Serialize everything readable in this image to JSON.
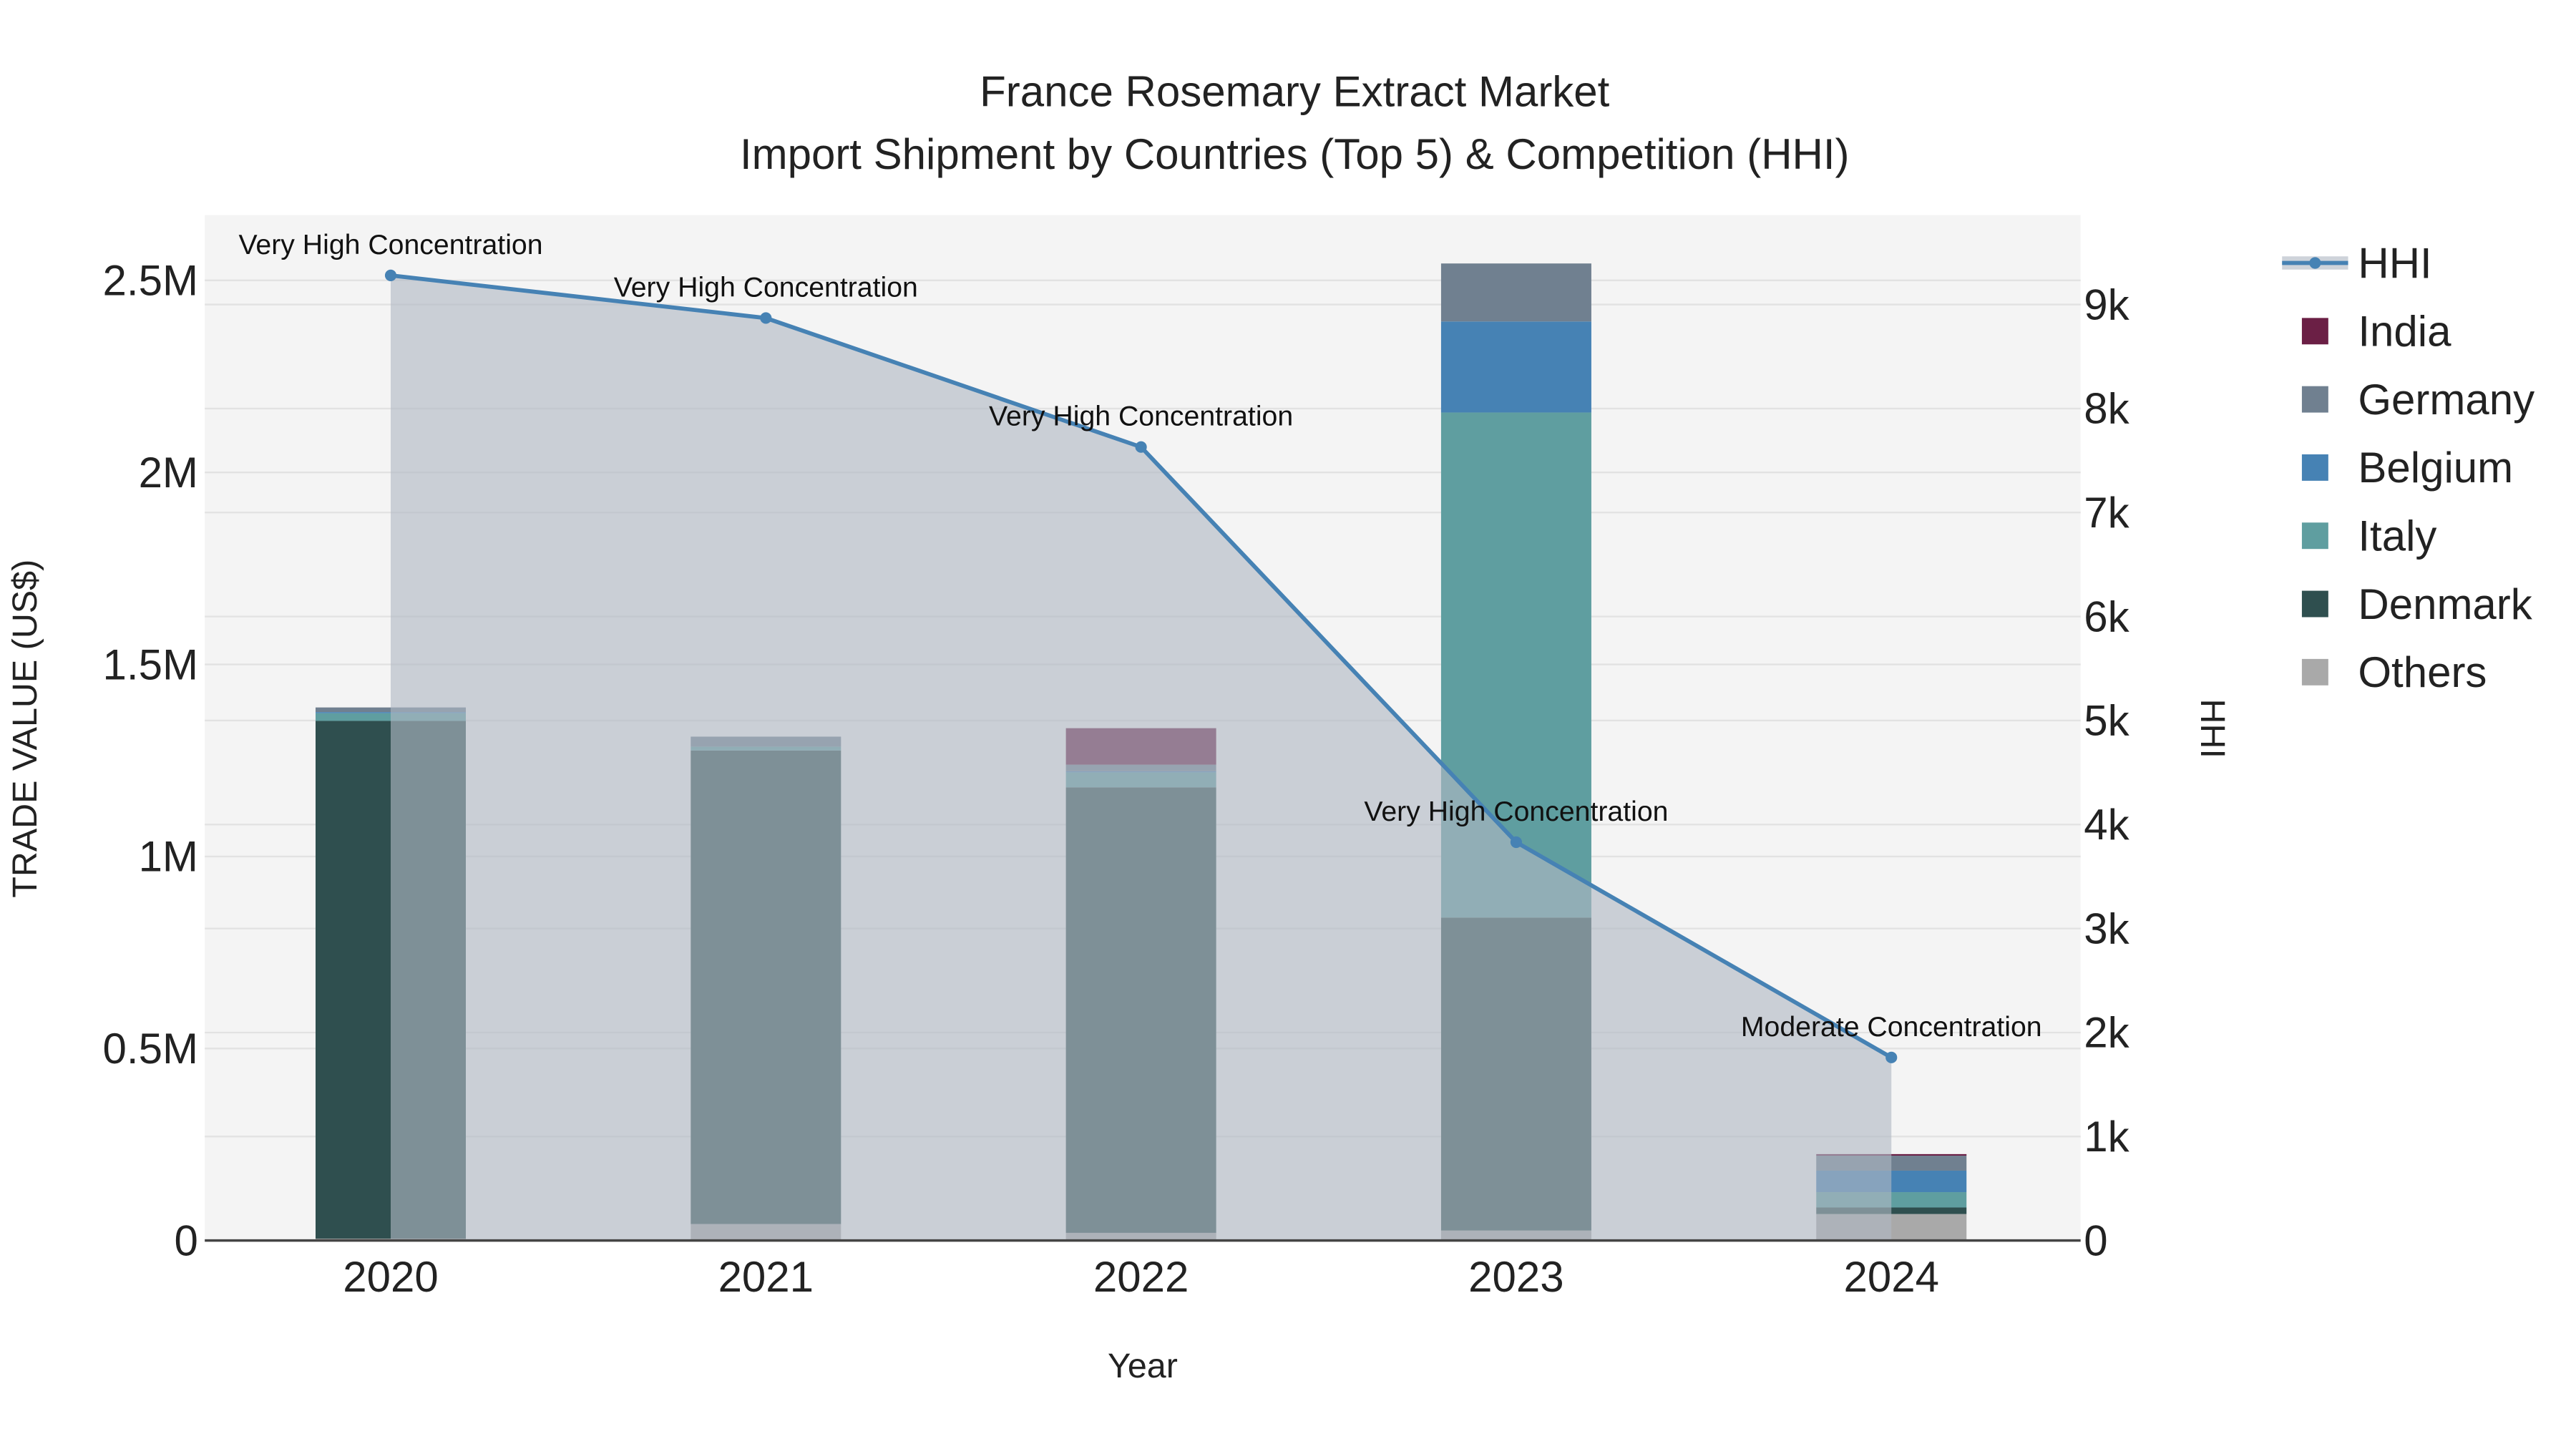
{
  "chart_data": {
    "type": "bar",
    "title": "France Rosemary Extract Market",
    "subtitle": "Import Shipment by Countries (Top 5) & Competition (HHI)",
    "xlabel": "Year",
    "ylabel": "TRADE VALUE (US$)",
    "y2label": "HHI",
    "categories": [
      "2020",
      "2021",
      "2022",
      "2023",
      "2024"
    ],
    "ylim": [
      0,
      2670000
    ],
    "y2lim": [
      0,
      9860
    ],
    "yticks": [
      {
        "v": 0,
        "label": "0"
      },
      {
        "v": 500000,
        "label": "0.5M"
      },
      {
        "v": 1000000,
        "label": "1M"
      },
      {
        "v": 1500000,
        "label": "1.5M"
      },
      {
        "v": 2000000,
        "label": "2M"
      },
      {
        "v": 2500000,
        "label": "2.5M"
      }
    ],
    "y2ticks": [
      {
        "v": 0,
        "label": "0"
      },
      {
        "v": 1000,
        "label": "1k"
      },
      {
        "v": 2000,
        "label": "2k"
      },
      {
        "v": 3000,
        "label": "3k"
      },
      {
        "v": 4000,
        "label": "4k"
      },
      {
        "v": 5000,
        "label": "5k"
      },
      {
        "v": 6000,
        "label": "6k"
      },
      {
        "v": 7000,
        "label": "7k"
      },
      {
        "v": 8000,
        "label": "8k"
      },
      {
        "v": 9000,
        "label": "9k"
      }
    ],
    "series": [
      {
        "name": "Others",
        "color": "#a9a9a9",
        "values": [
          5000,
          43000,
          20000,
          26000,
          69000
        ]
      },
      {
        "name": "Denmark",
        "color": "#2f4f4f",
        "values": [
          1348000,
          1233000,
          1160000,
          815000,
          17000
        ]
      },
      {
        "name": "Italy",
        "color": "#5f9ea0",
        "values": [
          20000,
          10000,
          39000,
          1315000,
          40000
        ]
      },
      {
        "name": "Belgium",
        "color": "#4682b4",
        "values": [
          3000,
          0,
          3000,
          237000,
          56000
        ]
      },
      {
        "name": "Germany",
        "color": "#708090",
        "values": [
          12000,
          26000,
          17000,
          151000,
          39000
        ]
      },
      {
        "name": "India",
        "color": "#6b1f45",
        "values": [
          0,
          0,
          95000,
          0,
          4000
        ]
      }
    ],
    "hhi": {
      "name": "HHI",
      "color": "#4682b4",
      "values": [
        9280,
        8870,
        7630,
        3830,
        1760
      ],
      "annotations": [
        "Very High Concentration",
        "Very High Concentration",
        "Very High Concentration",
        "Very High Concentration",
        "Moderate Concentration"
      ]
    },
    "legend_order": [
      "HHI",
      "India",
      "Germany",
      "Belgium",
      "Italy",
      "Denmark",
      "Others"
    ],
    "legend_placement": "right",
    "grid": true
  }
}
